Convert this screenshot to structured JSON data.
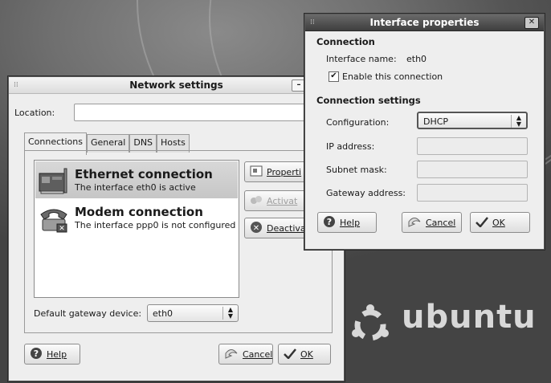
{
  "desktop": {
    "brand_text": "ubuntu",
    "background_color": "#5a5a5a"
  },
  "network_window": {
    "title": "Network settings",
    "minimize_glyph": "–",
    "location_label": "Location:",
    "location_value": "",
    "tabs": [
      {
        "label": "Connections",
        "active": true
      },
      {
        "label": "General",
        "active": false
      },
      {
        "label": "DNS",
        "active": false
      },
      {
        "label": "Hosts",
        "active": false
      }
    ],
    "connections": [
      {
        "title": "Ethernet connection",
        "subtitle": "The interface eth0 is active",
        "icon": "ethernet-card-icon",
        "selected": true
      },
      {
        "title": "Modem connection",
        "subtitle": "The interface ppp0 is not configured",
        "icon": "modem-phone-icon",
        "selected": false
      }
    ],
    "side_buttons": {
      "properties": "Properti",
      "activate": "Activat",
      "deactivate": "Deactiva"
    },
    "gateway_label": "Default gateway device:",
    "gateway_value": "eth0",
    "help_label": "Help",
    "cancel_label": "Cancel",
    "ok_label": "OK"
  },
  "props_window": {
    "title": "Interface properties",
    "close_glyph": "✕",
    "section_connection": "Connection",
    "interface_name_label": "Interface name:",
    "interface_name_value": "eth0",
    "enable_label": "Enable this connection",
    "enable_checked": true,
    "section_settings": "Connection settings",
    "configuration_label": "Configuration:",
    "configuration_value": "DHCP",
    "ip_label": "IP address:",
    "ip_value": "",
    "subnet_label": "Subnet mask:",
    "subnet_value": "",
    "gateway_label": "Gateway address:",
    "gateway_value": "",
    "help_label": "Help",
    "cancel_label": "Cancel",
    "ok_label": "OK"
  }
}
